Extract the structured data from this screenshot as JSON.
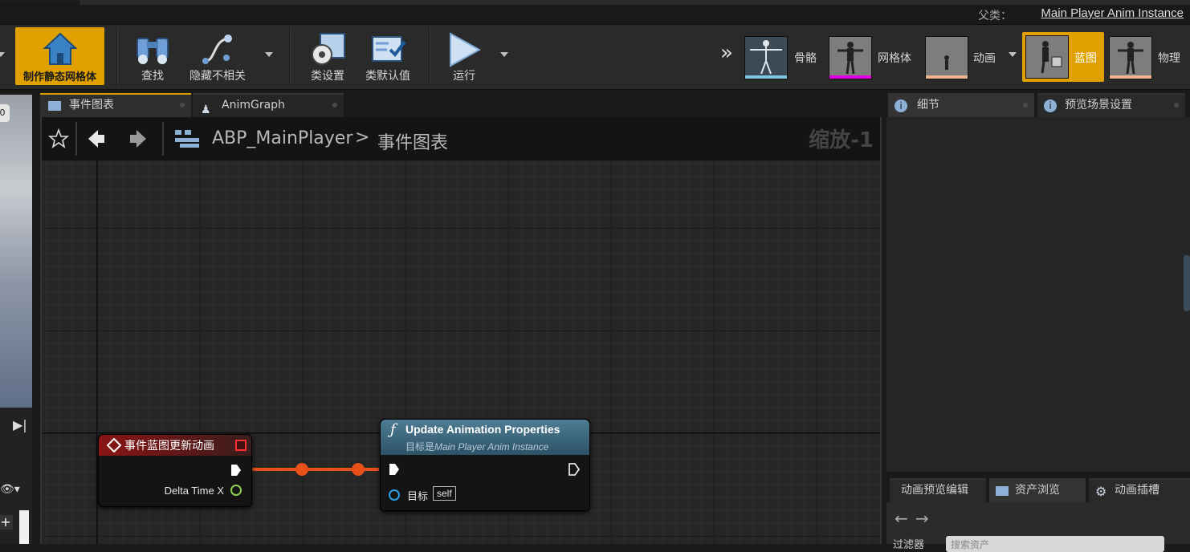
{
  "parent": {
    "label": "父类：",
    "value": "Main Player Anim Instance"
  },
  "toolbar": {
    "make_static_mesh": "制作静态网格体",
    "find": "查找",
    "hide_unrelated": "隐藏不相关",
    "class_settings": "类设置",
    "class_defaults": "类默认值",
    "run": "运行"
  },
  "modes": {
    "more": "»",
    "skeleton": "骨骼",
    "mesh": "网格体",
    "animation": "动画",
    "blueprint": "蓝图",
    "physics": "物理"
  },
  "doc_tabs": {
    "event_graph": "事件图表",
    "anim_graph": "AnimGraph"
  },
  "graph": {
    "breadcrumb_root": "ABP_MainPlayer",
    "breadcrumb_sep": ">",
    "breadcrumb_leaf": "事件图表",
    "zoom": "缩放-1"
  },
  "event_node": {
    "title": "事件蓝图更新动画",
    "pin_delta": "Delta Time X"
  },
  "func_node": {
    "title": "Update Animation Properties",
    "subtitle_prefix": "目标是",
    "subtitle_class": "Main Player Anim Instance",
    "target_label": "目标",
    "target_value": "self"
  },
  "right_tabs": {
    "details": "细节",
    "preview_scene": "预览场景设置"
  },
  "bottom_tabs": {
    "anim_preview": "动画预览编辑",
    "asset_browser": "资产浏览",
    "anim_slots": "动画插槽"
  },
  "asset_browser": {
    "filter_label": "过滤器",
    "search_placeholder": "搜索资产"
  },
  "colors": {
    "accent": "#e0a100",
    "exec_wire": "#e8501a",
    "event_header": "#8a1515",
    "func_header": "#4f7c93"
  }
}
